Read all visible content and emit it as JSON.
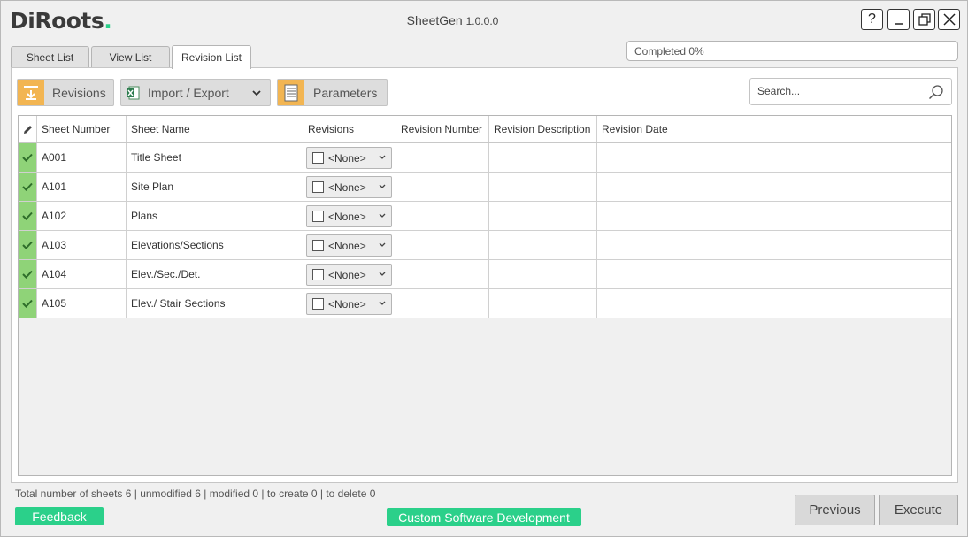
{
  "app": {
    "logo_text": "DiRoots",
    "title": "SheetGen",
    "version": "1.0.0.0"
  },
  "window_controls": {
    "help_label": "?"
  },
  "progress": {
    "text": "Completed 0%",
    "percent": 0
  },
  "tabs": [
    {
      "label": "Sheet List",
      "active": false
    },
    {
      "label": "View List",
      "active": false
    },
    {
      "label": "Revision List",
      "active": true
    }
  ],
  "toolbar": {
    "revisions_label": "Revisions",
    "import_export_label": "Import / Export",
    "parameters_label": "Parameters",
    "search_placeholder": "Search..."
  },
  "table": {
    "columns": [
      "Sheet Number",
      "Sheet Name",
      "Revisions",
      "Revision Number",
      "Revision Description",
      "Revision Date"
    ],
    "rows": [
      {
        "sheet_number": "A001",
        "sheet_name": "Title Sheet",
        "revisions": "<None>",
        "revision_number": "",
        "revision_description": "",
        "revision_date": ""
      },
      {
        "sheet_number": "A101",
        "sheet_name": "Site Plan",
        "revisions": "<None>",
        "revision_number": "",
        "revision_description": "",
        "revision_date": ""
      },
      {
        "sheet_number": "A102",
        "sheet_name": "Plans",
        "revisions": "<None>",
        "revision_number": "",
        "revision_description": "",
        "revision_date": ""
      },
      {
        "sheet_number": "A103",
        "sheet_name": "Elevations/Sections",
        "revisions": "<None>",
        "revision_number": "",
        "revision_description": "",
        "revision_date": ""
      },
      {
        "sheet_number": "A104",
        "sheet_name": "Elev./Sec./Det.",
        "revisions": "<None>",
        "revision_number": "",
        "revision_description": "",
        "revision_date": ""
      },
      {
        "sheet_number": "A105",
        "sheet_name": "Elev./ Stair Sections",
        "revisions": "<None>",
        "revision_number": "",
        "revision_description": "",
        "revision_date": ""
      }
    ]
  },
  "status_text": "Total number of sheets 6 | unmodified 6 | modified 0 | to create 0 | to delete 0",
  "footer": {
    "feedback_label": "Feedback",
    "custom_dev_label": "Custom Software Development",
    "previous_label": "Previous",
    "execute_label": "Execute"
  },
  "colors": {
    "accent_green": "#2bd08a",
    "row_indicator_green": "#8fd378",
    "toolbar_icon_orange": "#f2b552"
  }
}
